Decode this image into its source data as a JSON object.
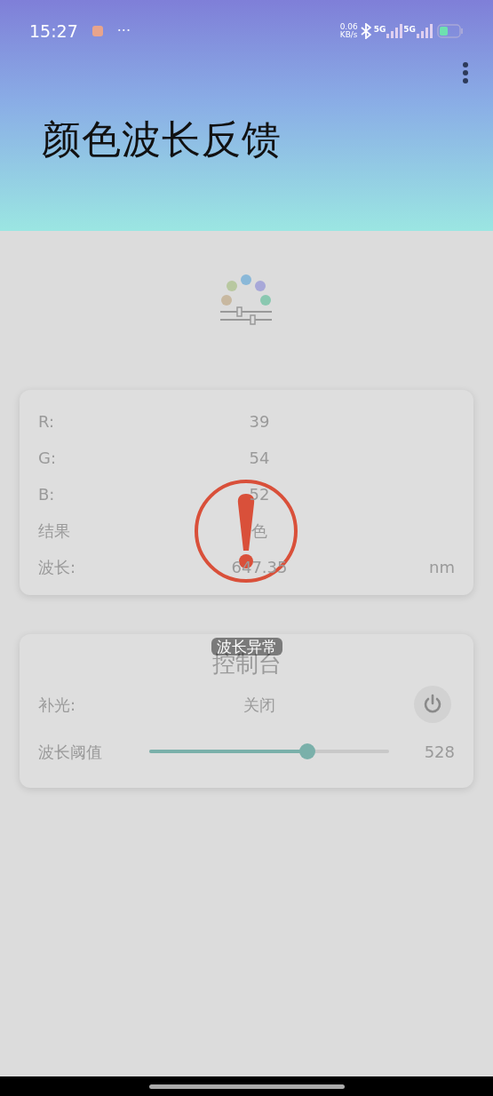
{
  "status_bar": {
    "time": "15:27",
    "more": "···",
    "speed": "0.06",
    "speed_unit": "KB/s",
    "networks": [
      "5G",
      "5G"
    ]
  },
  "app_bar": {
    "title": "颜色波长反馈"
  },
  "readings": [
    {
      "label": "R:",
      "value": "39"
    },
    {
      "label": "G:",
      "value": "54"
    },
    {
      "label": "B:",
      "value": "52"
    },
    {
      "label": "结果",
      "value": "色"
    },
    {
      "label": "波长:",
      "value": "647.35",
      "unit": "nm"
    }
  ],
  "console": {
    "title": "控制台",
    "light_label": "补光:",
    "light_state": "关闭",
    "light_on": false,
    "threshold_label": "波长阈值",
    "level": 0.66,
    "threshold_value": "528"
  },
  "alert": {
    "message": "波长异常"
  }
}
